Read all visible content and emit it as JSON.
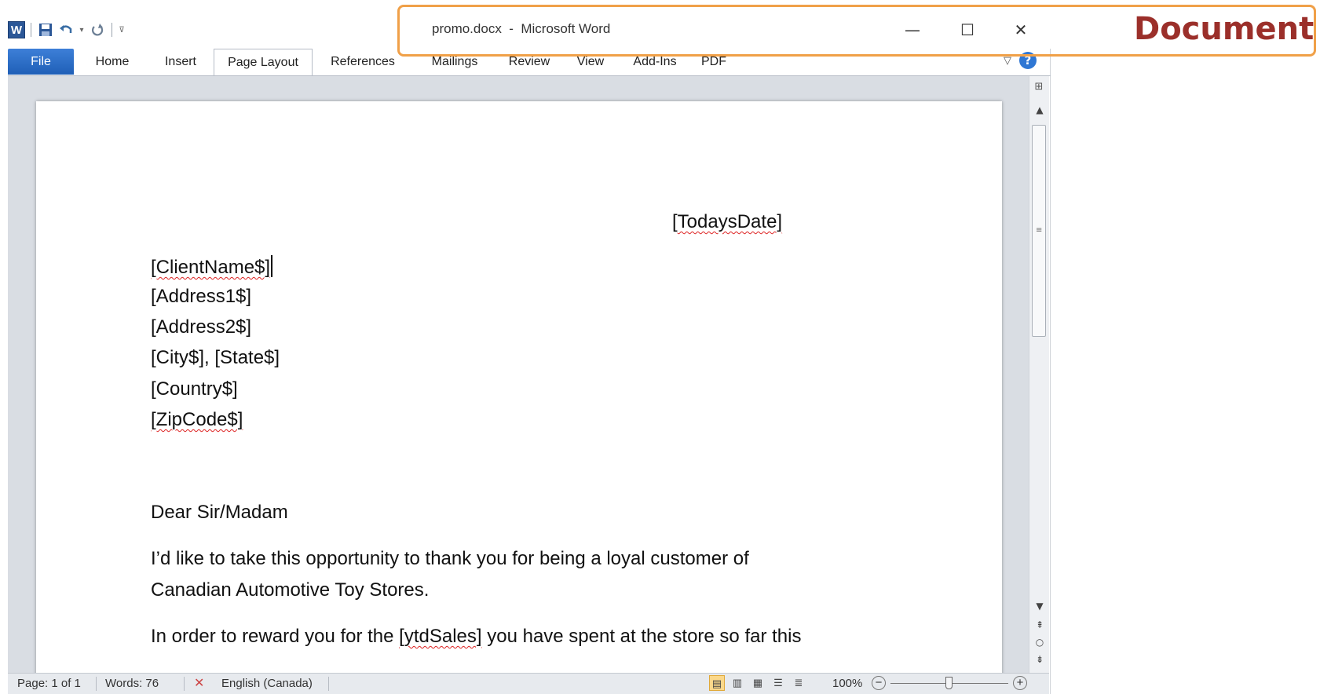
{
  "window": {
    "title": "promo.docx  -  Microsoft Word",
    "app_logo": "W",
    "controls": {
      "minimize": "—",
      "maximize": "☐",
      "close": "✕"
    }
  },
  "qat": {
    "save_icon": "save-icon",
    "undo_icon": "undo-icon",
    "redo_icon": "redo-icon",
    "customize_icon": "customize-qat-icon"
  },
  "ribbon": {
    "tabs": [
      {
        "label": "File"
      },
      {
        "label": "Home"
      },
      {
        "label": "Insert"
      },
      {
        "label": "Page Layout"
      },
      {
        "label": "References"
      },
      {
        "label": "Mailings"
      },
      {
        "label": "Review"
      },
      {
        "label": "View"
      },
      {
        "label": "Add-Ins"
      },
      {
        "label": "PDF"
      }
    ],
    "active_tab": "Page Layout"
  },
  "document": {
    "date_field": "[TodaysDate]",
    "address": [
      "[ClientName$]",
      "[Address1$]",
      "[Address2$]",
      "[City$], [State$]",
      "[Country$]",
      "[ZipCode$]"
    ],
    "salutation": "Dear Sir/Madam",
    "paragraph1_line1": "I’d like to take this opportunity to thank you for being a loyal customer of",
    "paragraph1_line2": "Canadian Automotive Toy Stores.",
    "paragraph2_prefix": "In order to reward you for the ",
    "paragraph2_field": "[ytdSales]",
    "paragraph2_suffix": " you have spent at the store so far this"
  },
  "status_bar": {
    "page": "Page: 1 of 1",
    "words": "Words: 76",
    "language": "English (Canada)",
    "zoom": "100%",
    "zoom_level_percent": 100
  },
  "annotation": {
    "label": "Document",
    "color": "#9b2f2a",
    "border_color": "#f0a048"
  }
}
